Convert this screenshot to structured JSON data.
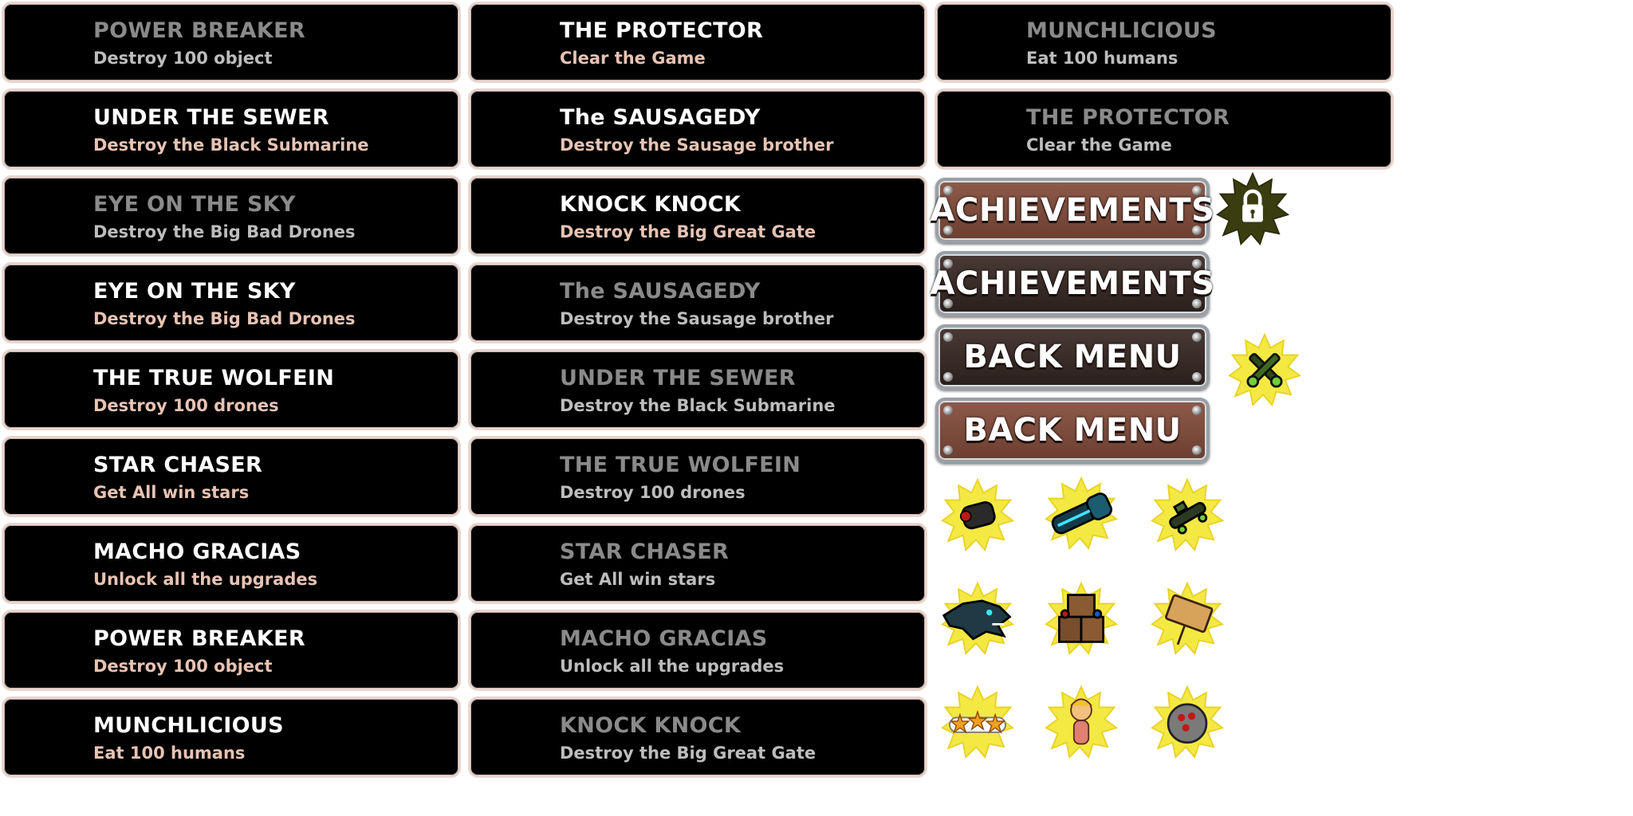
{
  "achievements_left": [
    {
      "title": "POWER BREAKER",
      "desc": "Destroy 100 object",
      "state": "locked"
    },
    {
      "title": "UNDER THE SEWER",
      "desc": "Destroy the Black Submarine",
      "state": "unlocked"
    },
    {
      "title": "EYE ON THE SKY",
      "desc": "Destroy the Big Bad Drones",
      "state": "locked"
    },
    {
      "title": "EYE ON THE SKY",
      "desc": "Destroy the Big Bad Drones",
      "state": "unlocked"
    },
    {
      "title": "THE TRUE WOLFEIN",
      "desc": "Destroy 100 drones",
      "state": "unlocked"
    },
    {
      "title": "STAR CHASER",
      "desc": "Get All win stars",
      "state": "unlocked"
    },
    {
      "title": "MACHO GRACIAS",
      "desc": "Unlock all the upgrades",
      "state": "unlocked"
    },
    {
      "title": "POWER BREAKER",
      "desc": "Destroy 100 object",
      "state": "unlocked"
    },
    {
      "title": "MUNCHLICIOUS",
      "desc": "Eat 100 humans",
      "state": "unlocked"
    }
  ],
  "achievements_middle": [
    {
      "title": "THE PROTECTOR",
      "desc": "Clear the Game",
      "state": "unlocked"
    },
    {
      "title": "The SAUSAGEDY",
      "desc": "Destroy the Sausage brother",
      "state": "unlocked"
    },
    {
      "title": "KNOCK KNOCK",
      "desc": "Destroy the Big Great Gate",
      "state": "unlocked"
    },
    {
      "title": "The SAUSAGEDY",
      "desc": "Destroy the Sausage brother",
      "state": "locked"
    },
    {
      "title": "UNDER THE SEWER",
      "desc": "Destroy the Black Submarine",
      "state": "locked"
    },
    {
      "title": "THE TRUE WOLFEIN",
      "desc": "Destroy 100 drones",
      "state": "locked"
    },
    {
      "title": "STAR CHASER",
      "desc": "Get All win stars",
      "state": "locked"
    },
    {
      "title": "MACHO GRACIAS",
      "desc": "Unlock all the upgrades",
      "state": "locked"
    },
    {
      "title": "KNOCK KNOCK",
      "desc": "Destroy the Big Great Gate",
      "state": "locked"
    }
  ],
  "achievements_right": [
    {
      "title": "MUNCHLICIOUS",
      "desc": "Eat 100 humans",
      "state": "locked"
    },
    {
      "title": "THE PROTECTOR",
      "desc": "Clear the Game",
      "state": "locked"
    }
  ],
  "buttons": {
    "achievements_label": "ACHIEVEMENTS",
    "back_menu_label": "BACK MENU"
  },
  "badges": [
    {
      "icon": "padlock-icon"
    },
    {
      "icon": "crossed-guns-icon"
    },
    {
      "icon": "cannon-icon"
    },
    {
      "icon": "power-glove-icon"
    },
    {
      "icon": "drone-icon"
    },
    {
      "icon": "dragon-head-icon"
    },
    {
      "icon": "crates-icon"
    },
    {
      "icon": "yum-sign-icon"
    },
    {
      "icon": "three-stars-icon"
    },
    {
      "icon": "sausage-girl-icon"
    },
    {
      "icon": "bowling-ball-icon"
    }
  ],
  "colors": {
    "card_bg": "#000000",
    "card_border": "#e8d6cf",
    "title_unlocked": "#ffffff",
    "desc_unlocked": "#e7c3b3",
    "title_locked": "#8a8a8a",
    "desc_locked": "#bdbdbd",
    "button_brown": "#7d4c3d",
    "button_dark": "#3a2c28",
    "badge_star": "#f4e843"
  }
}
